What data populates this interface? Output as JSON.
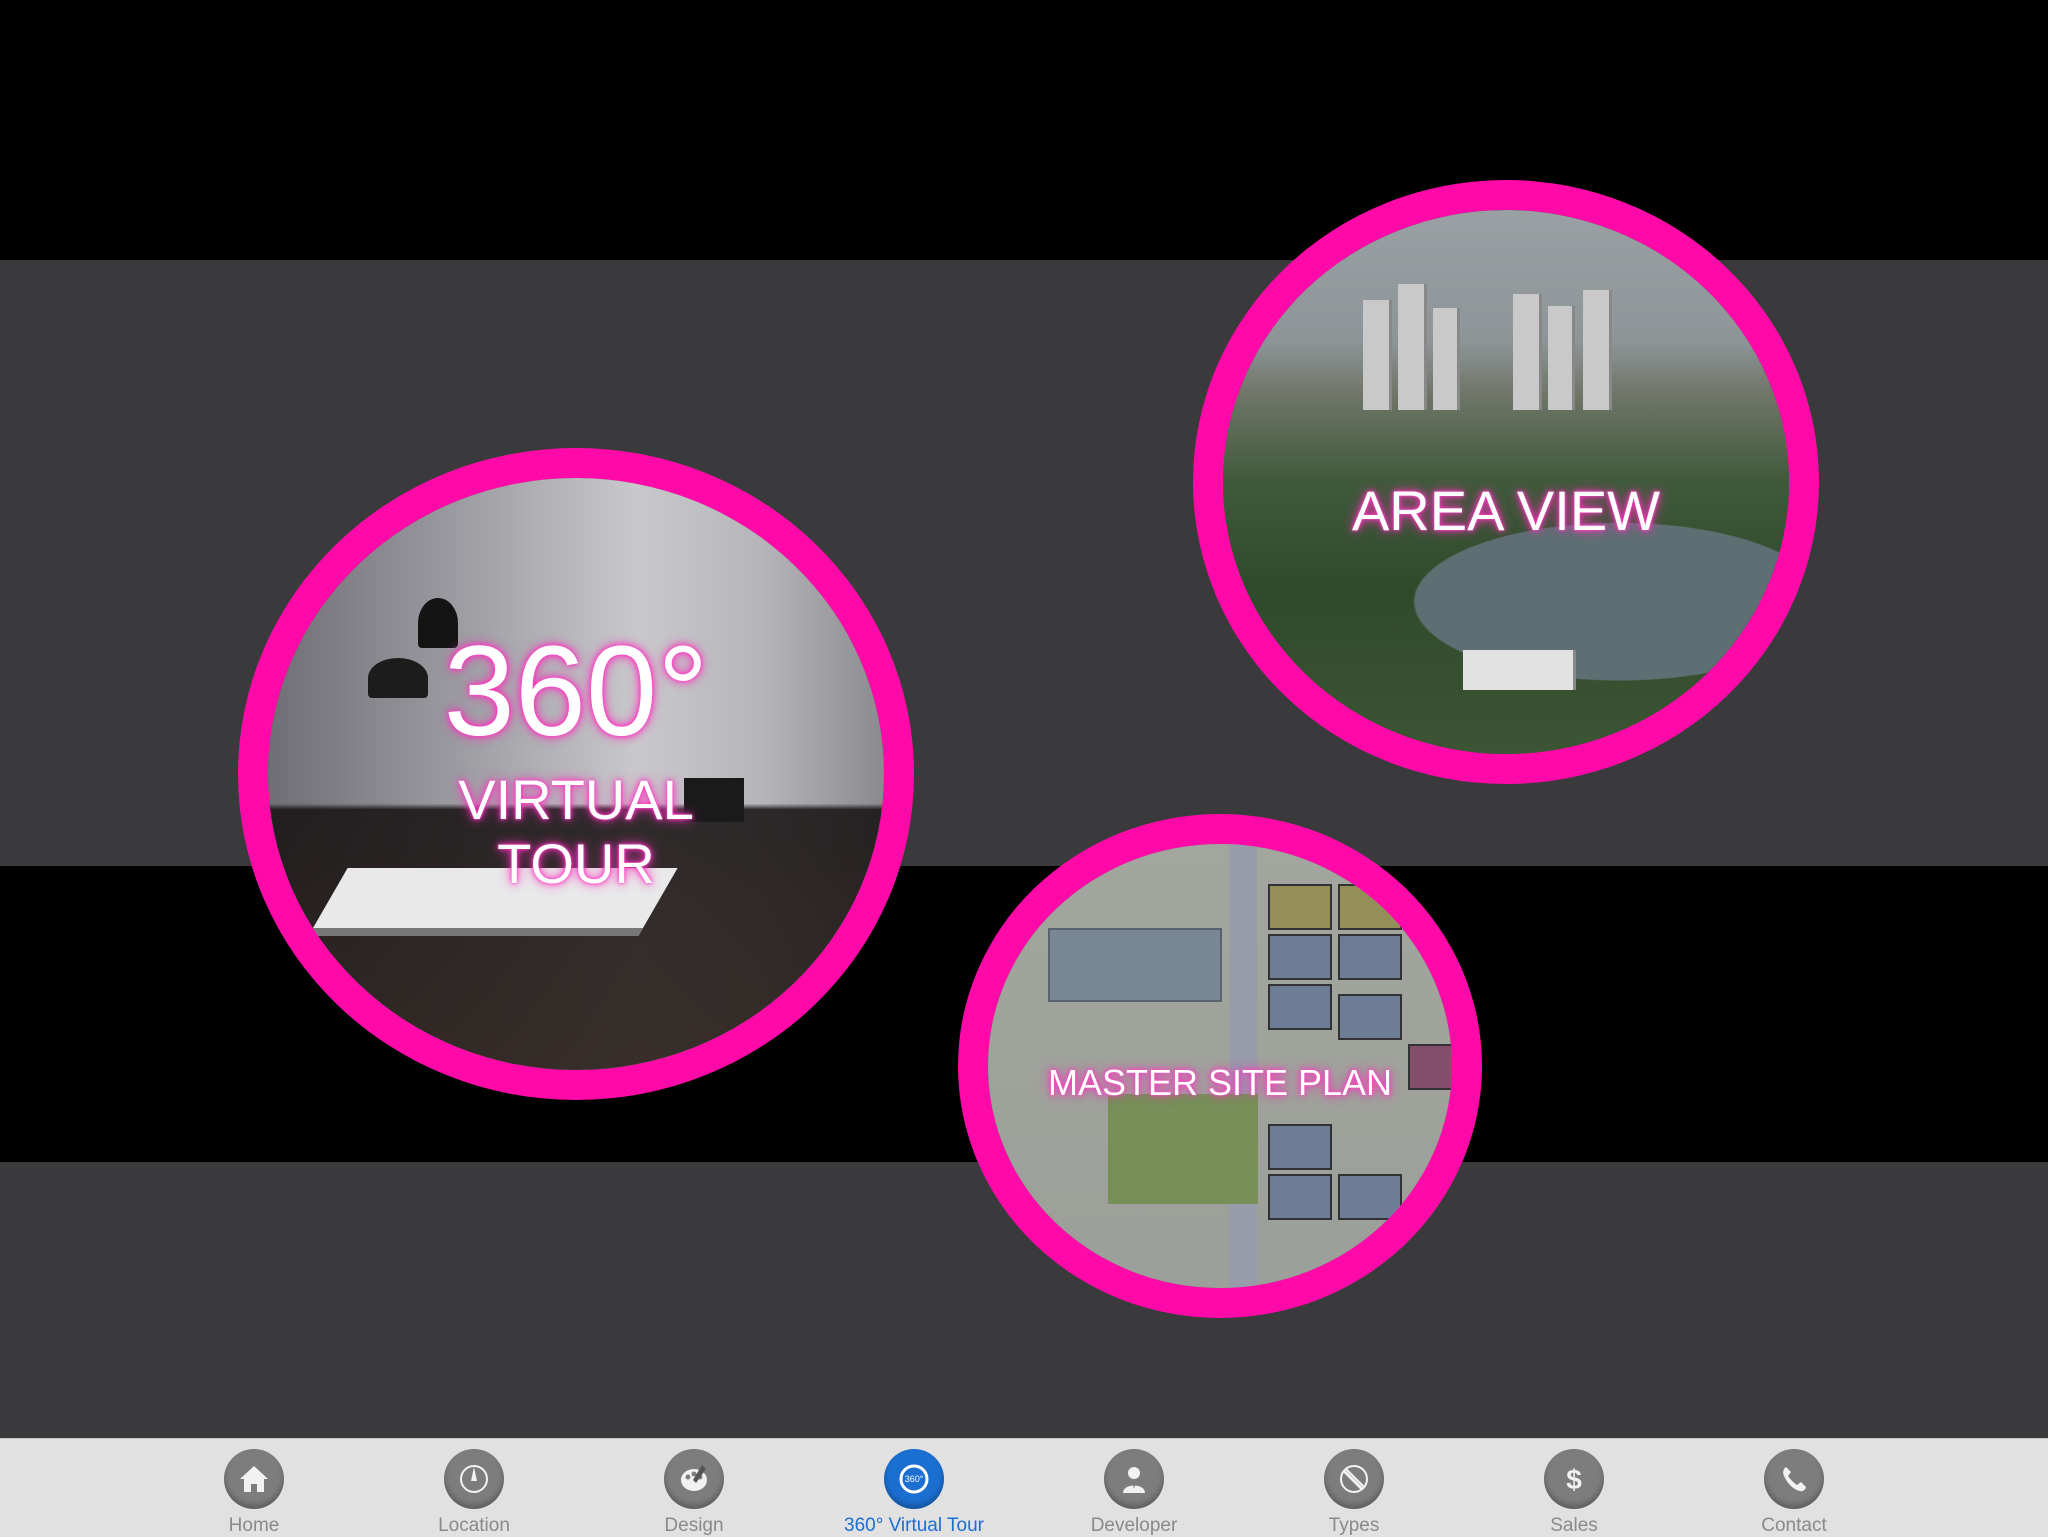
{
  "tour": {
    "big": "360°",
    "line1": "VIRTUAL",
    "line2": "TOUR"
  },
  "area": {
    "label": "AREA VIEW"
  },
  "plan": {
    "label": "MASTER SITE PLAN"
  },
  "colors": {
    "accent_pink": "#ff0aa8",
    "active_tab": "#1b6fd1",
    "tabbar_bg": "#e1e1e1"
  },
  "tabs": [
    {
      "label": "Home",
      "icon": "home-icon"
    },
    {
      "label": "Location",
      "icon": "location-icon"
    },
    {
      "label": "Design",
      "icon": "design-icon"
    },
    {
      "label": "360° Virtual Tour",
      "icon": "virtual-tour-icon",
      "active": true
    },
    {
      "label": "Developer",
      "icon": "developer-icon"
    },
    {
      "label": "Types",
      "icon": "types-icon"
    },
    {
      "label": "Sales",
      "icon": "sales-icon"
    },
    {
      "label": "Contact",
      "icon": "contact-icon"
    }
  ]
}
